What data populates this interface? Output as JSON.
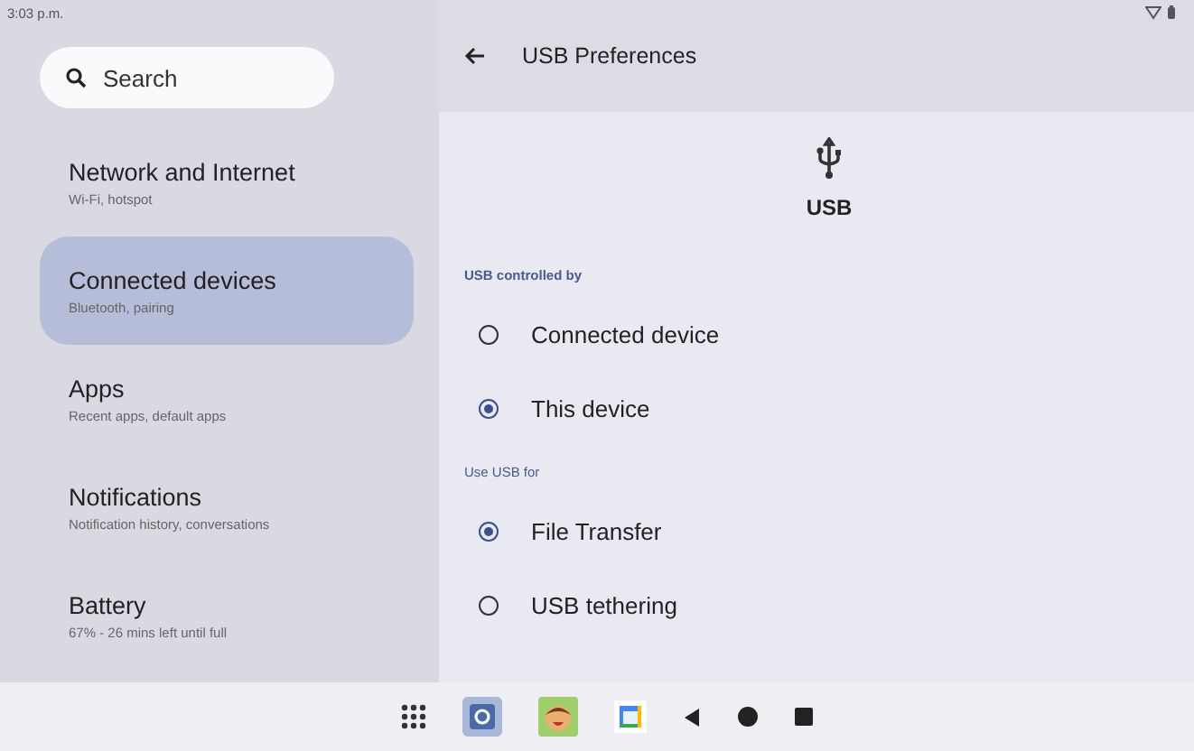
{
  "status_bar": {
    "time": "3:03 p.m."
  },
  "search": {
    "placeholder": "Search"
  },
  "sidebar": {
    "items": [
      {
        "title": "Network and Internet",
        "subtitle": "Wi-Fi, hotspot",
        "selected": false
      },
      {
        "title": "Connected devices",
        "subtitle": "Bluetooth, pairing",
        "selected": true
      },
      {
        "title": "Apps",
        "subtitle": "Recent apps, default apps",
        "selected": false
      },
      {
        "title": "Notifications",
        "subtitle": "Notification history, conversations",
        "selected": false
      },
      {
        "title": "Battery",
        "subtitle": "67% - 26 mins left until full",
        "selected": false
      }
    ]
  },
  "header": {
    "title": "USB Preferences"
  },
  "hero": {
    "label": "USB"
  },
  "sections": [
    {
      "heading": "USB controlled by",
      "options": [
        {
          "label": "Connected device",
          "selected": false
        },
        {
          "label": "This device",
          "selected": true
        }
      ]
    },
    {
      "heading": "Use USB for",
      "options": [
        {
          "label": "File Transfer",
          "selected": true
        },
        {
          "label": "USB tethering",
          "selected": false
        }
      ]
    }
  ]
}
